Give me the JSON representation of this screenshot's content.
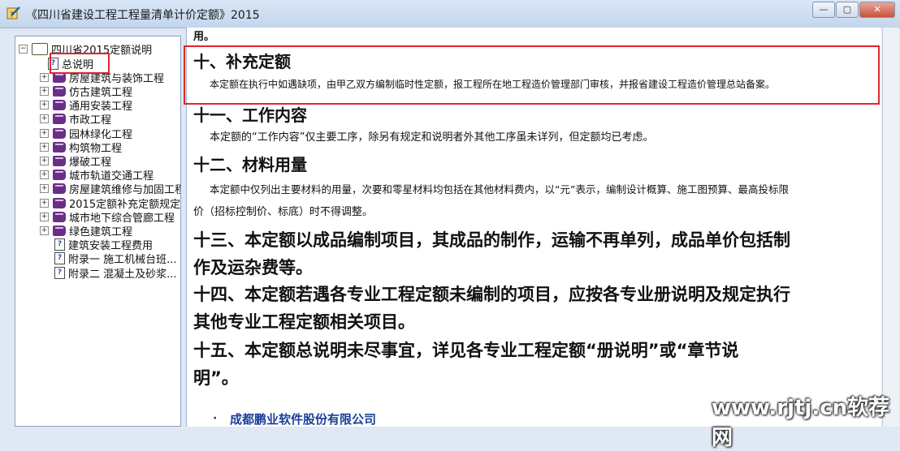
{
  "window": {
    "title": "《四川省建设工程工程量清单计价定额》2015",
    "buttons": {
      "minimize": "—",
      "maximize": "▢",
      "close": "✕"
    }
  },
  "tree": {
    "root": "四川省2015定额说明",
    "items": [
      {
        "label": "总说明",
        "icon": "page-icon"
      },
      {
        "label": "房屋建筑与装饰工程",
        "icon": "book-icon"
      },
      {
        "label": "仿古建筑工程",
        "icon": "book-icon"
      },
      {
        "label": "通用安装工程",
        "icon": "book-icon"
      },
      {
        "label": "市政工程",
        "icon": "book-icon"
      },
      {
        "label": "园林绿化工程",
        "icon": "book-icon"
      },
      {
        "label": "构筑物工程",
        "icon": "book-icon"
      },
      {
        "label": "爆破工程",
        "icon": "book-icon"
      },
      {
        "label": "城市轨道交通工程",
        "icon": "book-icon"
      },
      {
        "label": "房屋建筑维修与加固工程",
        "icon": "book-icon"
      },
      {
        "label": "2015定额补充定额规定",
        "icon": "book-icon"
      },
      {
        "label": "城市地下综合管廊工程",
        "icon": "book-icon"
      },
      {
        "label": "绿色建筑工程",
        "icon": "book-icon"
      },
      {
        "label": "建筑安装工程费用",
        "icon": "page-icon"
      },
      {
        "label": "附录一 施工机械台班...",
        "icon": "page-icon"
      },
      {
        "label": "附录二 混凝土及砂浆...",
        "icon": "page-icon"
      }
    ]
  },
  "content": {
    "top_fragment": "用。",
    "s10_title": "十、补充定额",
    "s10_body": "本定额在执行中如遇缺项，由甲乙双方编制临时性定额，报工程所在地工程造价管理部门审核，并报省建设工程造价管理总站备案。",
    "s11_title": "十一、工作内容",
    "s11_body": "本定额的“工作内容”仅主要工序，除另有规定和说明者外其他工序虽未详列，但定额均已考虑。",
    "s12_title": "十二、材料用量",
    "s12_body1": "本定额中仅列出主要材料的用量，次要和零星材料均包括在其他材料费内，以“元”表示，编制设计概算、施工图预算、最高投标限",
    "s12_body2": "价（招标控制价、标底）时不得调整。",
    "s13_line1": "十三、本定额以成品编制项目，其成品的制作，运输不再单列，成品单价包括制",
    "s13_line2": "作及运杂费等。",
    "s14_line1": "十四、本定额若遇各专业工程定额未编制的项目，应按各专业册说明及规定执行",
    "s14_line2": "其他专业工程定额相关项目。",
    "s15_line1": "十五、本定额总说明未尽事宜，详见各专业工程定额“册说明”或“章节说",
    "s15_line2": "明”。",
    "bullet": "·",
    "company": "成都鹏业软件股份有限公司"
  },
  "watermark": "www.rjtj.cn软荐网",
  "colors": {
    "highlight": "#e0262d",
    "company": "#1b3f9a",
    "book": "#6b2e86"
  }
}
